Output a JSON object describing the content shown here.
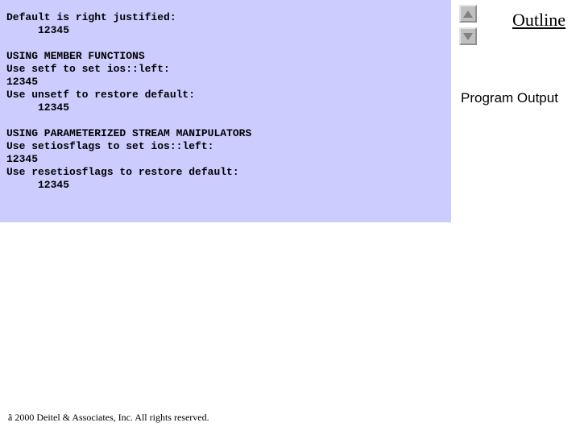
{
  "output": {
    "line1": "Default is right justified:",
    "line2": "     12345",
    "blank1": " ",
    "line3": "USING MEMBER FUNCTIONS",
    "line4": "Use setf to set ios::left:",
    "line5": "12345",
    "line6": "Use unsetf to restore default:",
    "line7": "     12345",
    "blank2": " ",
    "line8": "USING PARAMETERIZED STREAM MANIPULATORS",
    "line9": "Use setiosflags to set ios::left:",
    "line10": "12345",
    "line11": "Use resetiosflags to restore default:",
    "line12": "     12345"
  },
  "nav": {
    "outline_label": "Outline"
  },
  "section_label": "Program Output",
  "footer": {
    "copyright_symbol": "ã",
    "text": " 2000 Deitel & Associates, Inc.  All rights reserved."
  }
}
